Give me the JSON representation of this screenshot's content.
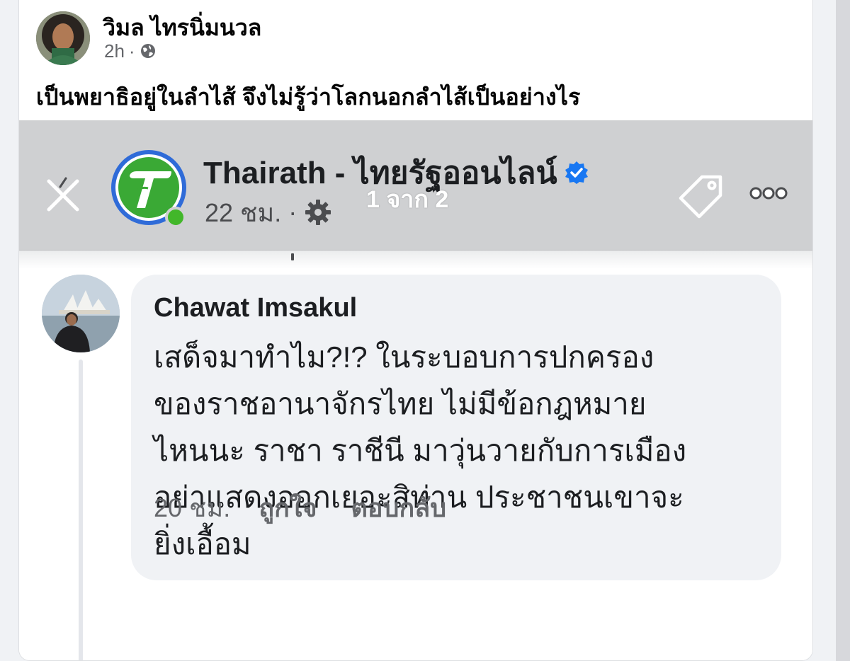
{
  "post": {
    "author": "วิมล ไทรนิ่มนวล",
    "time": "2h",
    "separator": "·",
    "audience_icon": "globe-icon",
    "text": "เป็นพยาธิอยู่ในลำไส้ จึงไม่รู้ว่าโลกนอกลำไส้เป็นอย่างไร"
  },
  "shared_screenshot": {
    "page_name": "Thairath - ไทยรัฐออนไลน์",
    "verified_icon": "verified-badge-icon",
    "time": "22 ชม.",
    "separator": "·",
    "audience_icon": "gear-icon",
    "pager": "1 จาก 2",
    "icons": [
      "close-icon",
      "tag-icon",
      "more-icon"
    ],
    "comment": {
      "author": "Chawat Imsakul",
      "lines": [
        "เสด็จมาทำไม?!? ในระบอบการปกครอง",
        "ของราชอานาจักรไทย ไม่มีข้อกฎหมาย",
        "ไหนนะ ราชา ราชีนี มาวุ่นวายกับการเมือง",
        "อย่าแสดงออกเยอะสิท่าน ประชาชนเขาจะ",
        "ยิ่งเอื้อม"
      ],
      "time": "20 ชม.",
      "like_label": "ถูกใจ",
      "reply_label": "ตอบกลับ"
    }
  },
  "colors": {
    "accent_blue": "#1877f2",
    "thairath_green": "#3aa935",
    "thairath_ring": "#2f6bd8",
    "bubble_bg": "#f0f2f5"
  }
}
